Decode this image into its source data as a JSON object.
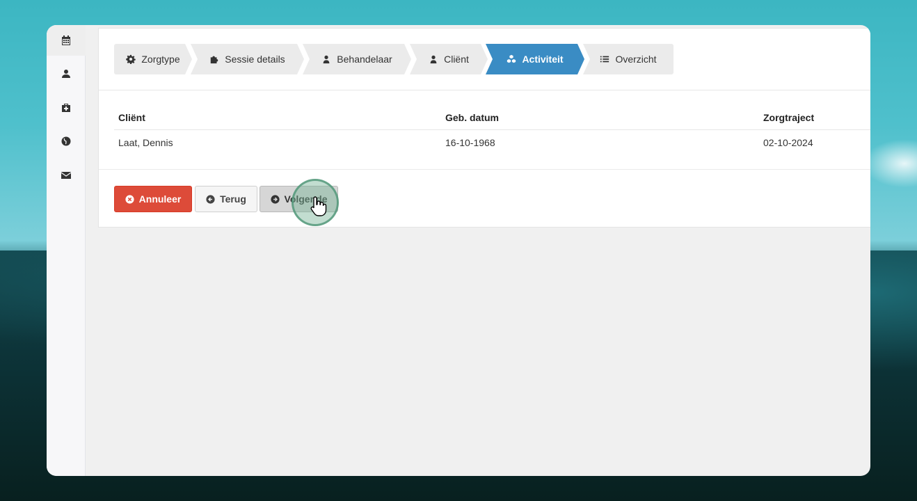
{
  "sidebar": {
    "items": [
      {
        "icon": "calendar-icon",
        "active": true
      },
      {
        "icon": "user-icon",
        "active": false
      },
      {
        "icon": "medkit-icon",
        "active": false
      },
      {
        "icon": "globe-icon",
        "active": false
      },
      {
        "icon": "envelope-icon",
        "active": false
      }
    ]
  },
  "wizard": {
    "steps": [
      {
        "label": "Zorgtype",
        "icon": "gear-icon"
      },
      {
        "label": "Sessie details",
        "icon": "puzzle-icon"
      },
      {
        "label": "Behandelaar",
        "icon": "user-icon"
      },
      {
        "label": "Cliënt",
        "icon": "user-icon"
      },
      {
        "label": "Activiteit",
        "icon": "cubes-icon",
        "active": true
      },
      {
        "label": "Overzicht",
        "icon": "list-icon"
      }
    ]
  },
  "table": {
    "headers": [
      "Cliënt",
      "Geb. datum",
      "Zorgtraject"
    ],
    "rows": [
      [
        "Laat, Dennis",
        "16-10-1968",
        "02-10-2024"
      ]
    ]
  },
  "actions": {
    "cancel_label": "Annuleer",
    "back_label": "Terug",
    "next_label": "Volgende"
  },
  "colors": {
    "active_step": "#3a8cc4",
    "cancel_button": "#dd4b39"
  }
}
